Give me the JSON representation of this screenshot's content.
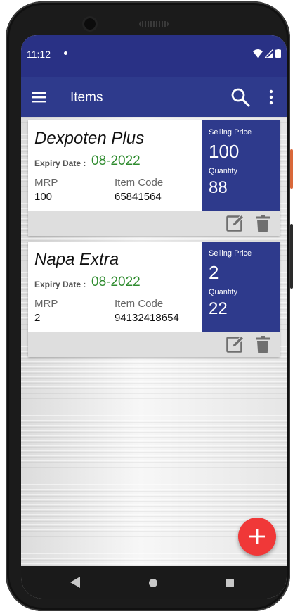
{
  "status_bar": {
    "time": "11:12"
  },
  "app_bar": {
    "title": "Items"
  },
  "items": [
    {
      "name": "Dexpoten Plus",
      "expiry_label": "Expiry Date :",
      "expiry": "08-2022",
      "mrp_label": "MRP",
      "mrp": "100",
      "code_label": "Item Code",
      "code": "65841564",
      "selling_price_label": "Selling Price",
      "selling_price": "100",
      "quantity_label": "Quantity",
      "quantity": "88"
    },
    {
      "name": "Napa Extra",
      "expiry_label": "Expiry Date :",
      "expiry": "08-2022",
      "mrp_label": "MRP",
      "mrp": "2",
      "code_label": "Item Code",
      "code": "94132418654",
      "selling_price_label": "Selling Price",
      "selling_price": "2",
      "quantity_label": "Quantity",
      "quantity": "22"
    }
  ],
  "icons": {
    "menu": "menu-icon",
    "search": "search-icon",
    "more": "more-vert-icon",
    "edit": "edit-icon",
    "delete": "delete-icon",
    "add": "add-icon",
    "back": "back-icon",
    "home": "home-icon",
    "recent": "recent-apps-icon"
  },
  "colors": {
    "primary": "#2e3a8c",
    "status_bar": "#293185",
    "expiry": "#2e8b2e",
    "fab": "#f03838"
  }
}
